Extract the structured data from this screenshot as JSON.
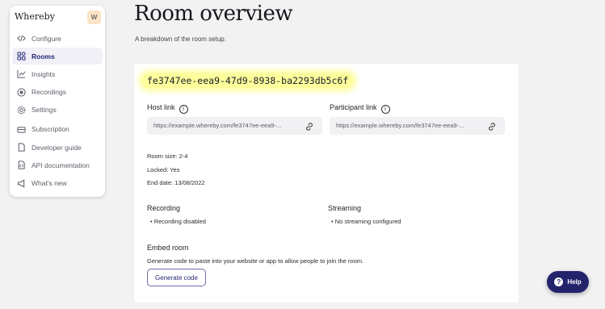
{
  "sidebar": {
    "brand": "Whereby",
    "avatar_initial": "W",
    "items": [
      {
        "label": "Configure",
        "icon": "code-icon"
      },
      {
        "label": "Rooms",
        "icon": "grid-icon",
        "active": true
      },
      {
        "label": "Insights",
        "icon": "chart-icon"
      },
      {
        "label": "Recordings",
        "icon": "record-icon"
      },
      {
        "label": "Settings",
        "icon": "gear-icon"
      },
      {
        "label": "Subscription",
        "icon": "card-icon"
      },
      {
        "label": "Developer guide",
        "icon": "document-icon"
      },
      {
        "label": "API documentation",
        "icon": "api-doc-icon"
      },
      {
        "label": "What's new",
        "icon": "megaphone-icon"
      }
    ]
  },
  "main": {
    "title": "Room overview",
    "subtitle": "A breakdown of the room setup."
  },
  "room": {
    "id": "fe3747ee-eea9-47d9-8938-ba2293db5c6f",
    "host_link_label": "Host link",
    "host_link_value": "https://example.whereby.com/fe3747ee-eea9-...",
    "participant_link_label": "Participant link",
    "participant_link_value": "https://example.whereby.com/fe3747ee-eea9-...",
    "room_size": "Room size: 2-4",
    "locked": "Locked: Yes",
    "end_date": "End date: 13/08/2022",
    "recording_label": "Recording",
    "recording_value": "• Recording disabled",
    "streaming_label": "Streaming",
    "streaming_value": "• No streaming configured",
    "embed_label": "Embed room",
    "embed_desc": "Generate code to paste into your website or app to allow people to join the room.",
    "generate_button": "Generate code"
  },
  "help": {
    "label": "Help"
  },
  "colors": {
    "accent": "#23236b",
    "highlight": "#fdfd9c",
    "active_bg": "#f1f0f6"
  }
}
